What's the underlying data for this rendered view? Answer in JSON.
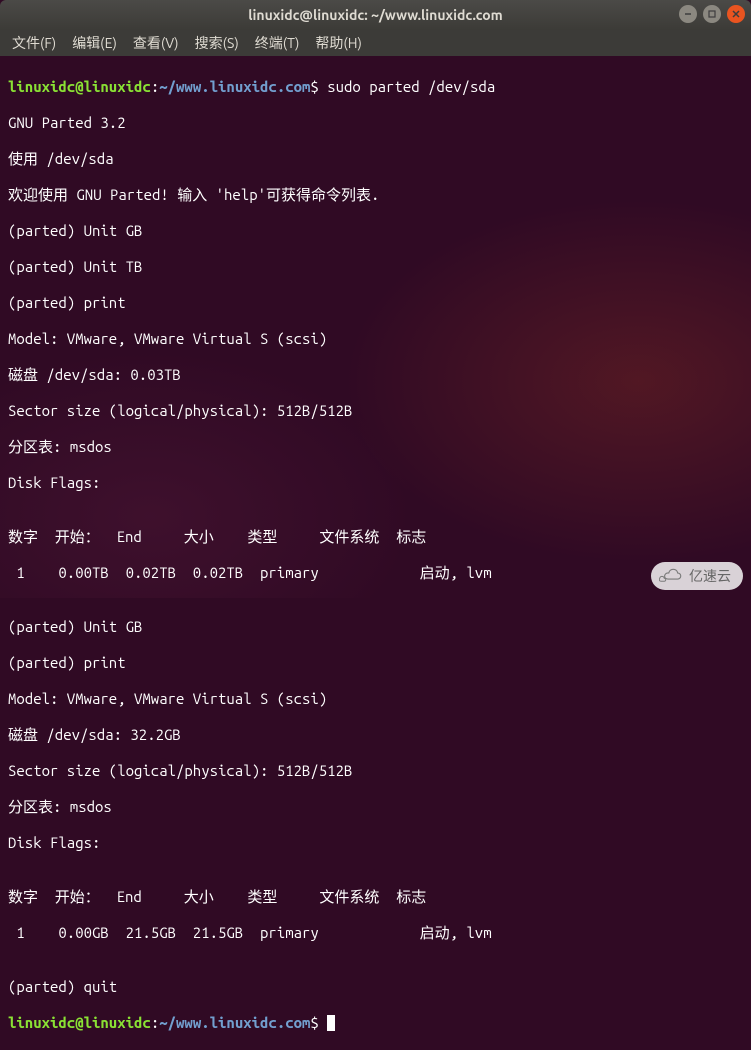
{
  "window": {
    "title": "linuxidc@linuxidc: ~/www.linuxidc.com"
  },
  "menu": {
    "file": "文件(F)",
    "edit": "编辑(E)",
    "view": "查看(V)",
    "search": "搜索(S)",
    "terminal": "终端(T)",
    "help": "帮助(H)"
  },
  "prompt": {
    "userhost": "linuxidc@linuxidc",
    "colon": ":",
    "path": "~/www.linuxidc.com",
    "dollar": "$ "
  },
  "cmd1": "sudo parted /dev/sda",
  "lines": {
    "l1": "GNU Parted 3.2",
    "l2": "使用 /dev/sda",
    "l3": "欢迎使用 GNU Parted! 输入 'help'可获得命令列表.",
    "l4": "(parted) Unit GB",
    "l5": "(parted) Unit TB",
    "l6": "(parted) print",
    "l7": "Model: VMware, VMware Virtual S (scsi)",
    "l8": "磁盘 /dev/sda: 0.03TB",
    "l9": "Sector size (logical/physical): 512B/512B",
    "l10": "分区表: msdos",
    "l11": "Disk Flags: ",
    "l12": "",
    "l13": "数字  开始：  End     大小    类型     文件系统  标志",
    "l14": " 1    0.00TB  0.02TB  0.02TB  primary            启动, lvm",
    "l15": "",
    "l16": "(parted) Unit GB",
    "l17": "(parted) print",
    "l18": "Model: VMware, VMware Virtual S (scsi)",
    "l19": "磁盘 /dev/sda: 32.2GB",
    "l20": "Sector size (logical/physical): 512B/512B",
    "l21": "分区表: msdos",
    "l22": "Disk Flags: ",
    "l23": "",
    "l24": "数字  开始：  End     大小    类型     文件系统  标志",
    "l25": " 1    0.00GB  21.5GB  21.5GB  primary            启动, lvm",
    "l26": "",
    "l27": "(parted) quit"
  },
  "watermark": {
    "text": "亿速云"
  }
}
